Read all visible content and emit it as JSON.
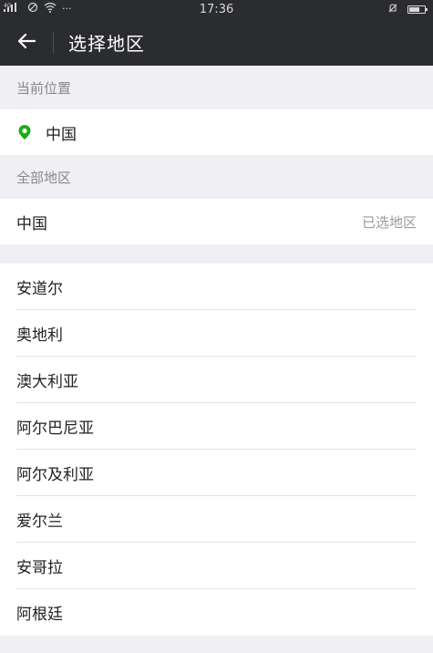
{
  "status_bar": {
    "network": "4G",
    "time": "17:36",
    "dots": "···",
    "battery_level": 0.7
  },
  "header": {
    "title": "选择地区"
  },
  "current_location": {
    "section_label": "当前位置",
    "value": "中国"
  },
  "all_regions": {
    "section_label": "全部地区",
    "selected_country": "中国",
    "selected_tag": "已选地区"
  },
  "countries": [
    "安道尔",
    "奥地利",
    "澳大利亚",
    "阿尔巴尼亚",
    "阿尔及利亚",
    "爱尔兰",
    "安哥拉",
    "阿根廷"
  ],
  "colors": {
    "bar": "#2b2c2f",
    "accent_green": "#1aad19"
  }
}
